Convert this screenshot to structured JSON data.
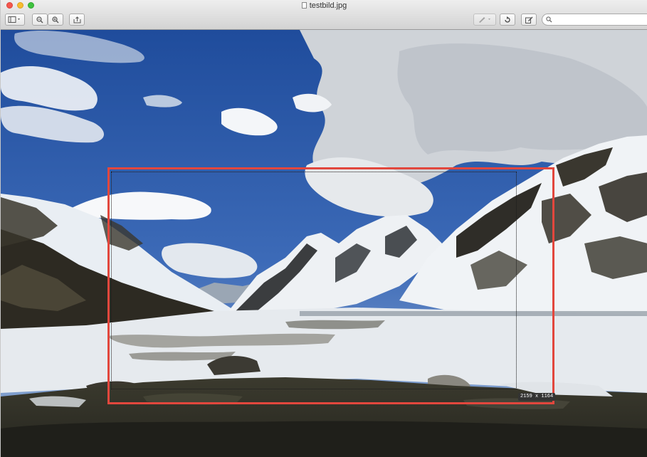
{
  "window": {
    "title": "testbild.jpg"
  },
  "toolbar": {
    "left_buttons": [
      "sidebar-toggle",
      "zoom-out",
      "zoom-in",
      "share"
    ],
    "right_buttons": [
      "markup-pen",
      "rotate",
      "edit"
    ],
    "search_placeholder": ""
  },
  "image": {
    "selection_size": "2159 x 1164"
  },
  "colors": {
    "selection_outline": "#e2473d",
    "sky": "#2e5aa8",
    "snow": "#e8ecef"
  }
}
